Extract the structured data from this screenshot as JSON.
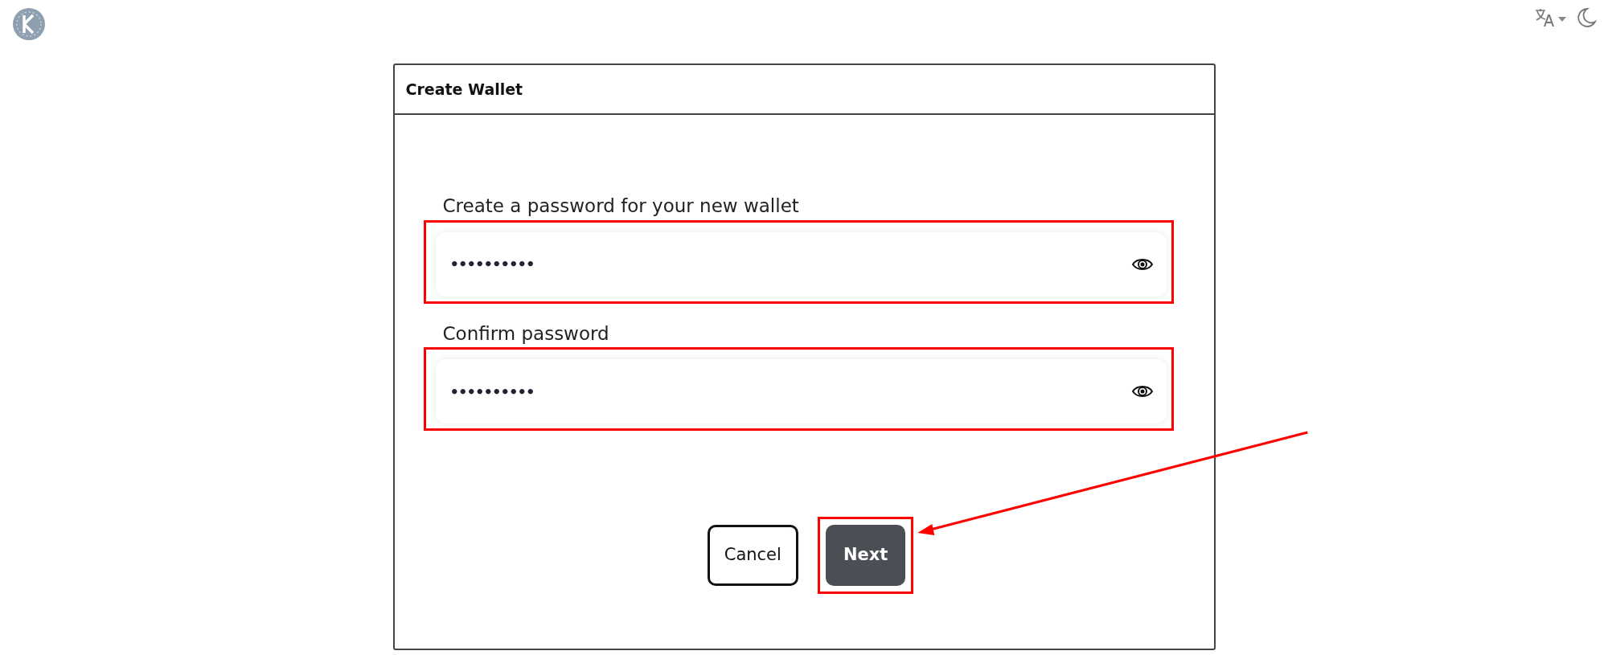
{
  "dialog": {
    "title": "Create Wallet",
    "fields": [
      {
        "label": "Create a password for your new wallet",
        "value": "••••••••••",
        "highlighted": true
      },
      {
        "label": "Confirm password",
        "value": "••••••••••",
        "highlighted": true
      }
    ],
    "buttons": [
      {
        "label": "Cancel",
        "kind": "secondary",
        "highlighted": false
      },
      {
        "label": "Next",
        "kind": "primary",
        "highlighted": true
      }
    ]
  }
}
